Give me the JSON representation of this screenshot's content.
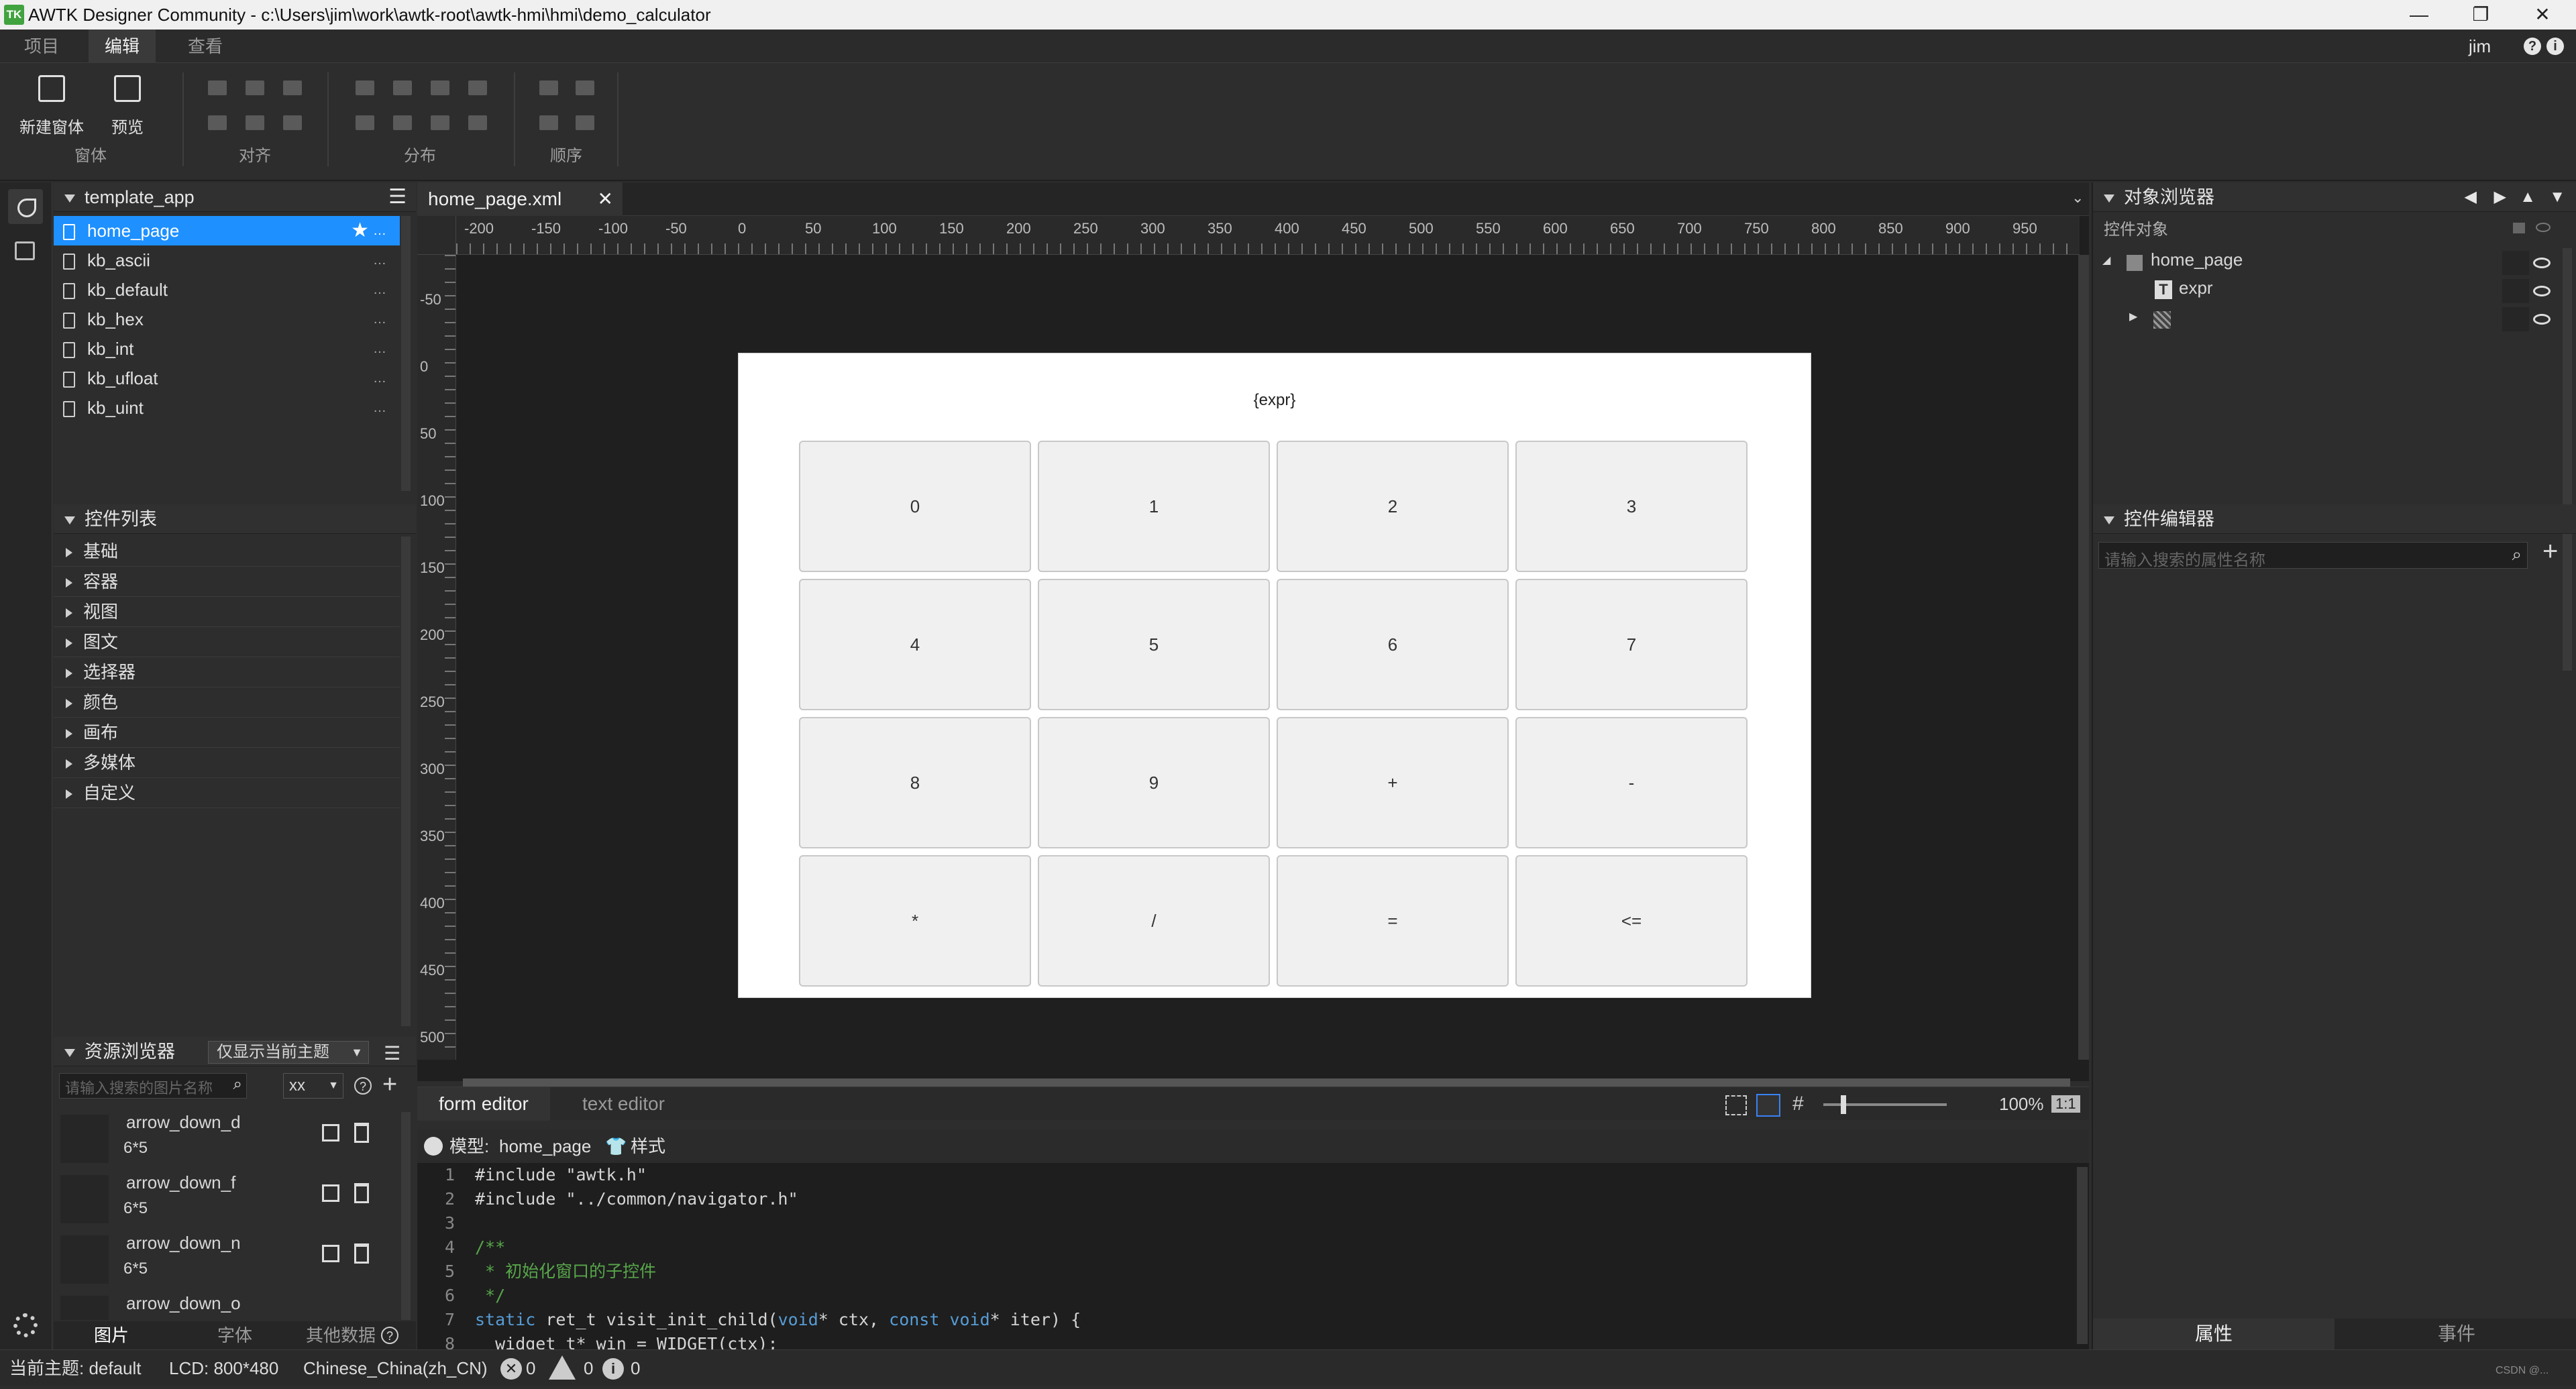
{
  "window": {
    "title": "AWTK Designer Community - c:\\Users\\jim\\work\\awtk-root\\awtk-hmi\\hmi\\demo_calculator",
    "logo": "TK",
    "controls": {
      "minimize": "—",
      "maximize": "❐",
      "close": "✕"
    }
  },
  "menubar": {
    "tabs": [
      "项目",
      "编辑",
      "查看"
    ],
    "user": "jim"
  },
  "ribbon": {
    "new_window": "新建窗体",
    "preview": "预览",
    "groups": {
      "window": "窗体",
      "align": "对齐",
      "distribute": "分布",
      "order": "顺序"
    }
  },
  "project_panel": {
    "title": "template_app",
    "files": [
      "home_page",
      "kb_ascii",
      "kb_default",
      "kb_hex",
      "kb_int",
      "kb_ufloat",
      "kb_uint"
    ],
    "selected": "home_page"
  },
  "widget_list": {
    "title": "控件列表",
    "categories": [
      "基础",
      "容器",
      "视图",
      "图文",
      "选择器",
      "颜色",
      "画布",
      "多媒体",
      "自定义"
    ]
  },
  "resource_browser": {
    "title": "资源浏览器",
    "filter": "仅显示当前主题",
    "search_placeholder": "请输入搜索的图片名称",
    "scale": "xx",
    "items": [
      {
        "name": "arrow_down_d",
        "size": "6*5"
      },
      {
        "name": "arrow_down_f",
        "size": "6*5"
      },
      {
        "name": "arrow_down_n",
        "size": "6*5"
      },
      {
        "name": "arrow_down_o",
        "size": ""
      }
    ],
    "tabs": [
      "图片",
      "字体",
      "其他数据"
    ]
  },
  "editor": {
    "file_tab": "home_page.xml",
    "ruler_h": [
      "-200",
      "-150",
      "-100",
      "-50",
      "0",
      "50",
      "100",
      "150",
      "200",
      "250",
      "300",
      "350",
      "400",
      "450",
      "500",
      "550",
      "600",
      "650",
      "700",
      "750",
      "800",
      "850",
      "900",
      "950"
    ],
    "ruler_v": [
      "-50",
      "0",
      "50",
      "100",
      "150",
      "200",
      "250",
      "300",
      "350",
      "400",
      "450",
      "500"
    ],
    "form": {
      "label": "{expr}",
      "keys": [
        "0",
        "1",
        "2",
        "3",
        "4",
        "5",
        "6",
        "7",
        "8",
        "9",
        "+",
        "-",
        "*",
        "/",
        "=",
        "<="
      ]
    },
    "bottom_tabs": [
      "form editor",
      "text editor"
    ],
    "zoom": "100%",
    "zoom_reset": "1:1"
  },
  "code_panel": {
    "model_label": "模型:",
    "model_name": "home_page",
    "style_label": "样式",
    "lines": [
      {
        "n": "1",
        "text": "#include \"awtk.h\""
      },
      {
        "n": "2",
        "text": "#include \"../common/navigator.h\""
      },
      {
        "n": "3",
        "text": ""
      },
      {
        "n": "4",
        "text": "/**"
      },
      {
        "n": "5",
        "text": " * 初始化窗口的子控件"
      },
      {
        "n": "6",
        "text": " */"
      },
      {
        "n": "7",
        "pre": "static ",
        "type": "ret_t",
        "mid": " visit_init_child(",
        "k1": "void",
        "m2": "* ctx, ",
        "k2": "const void",
        "end": "* iter) {"
      },
      {
        "n": "8",
        "text": "  widget_t* win = WIDGET(ctx);"
      }
    ]
  },
  "object_browser": {
    "title": "对象浏览器",
    "subtitle": "控件对象",
    "tree": [
      {
        "label": "home_page"
      },
      {
        "label": "expr"
      },
      {
        "label": ""
      }
    ]
  },
  "property_editor": {
    "title": "控件编辑器",
    "search_placeholder": "请输入搜索的属性名称",
    "tabs": [
      "属性",
      "事件"
    ]
  },
  "statusbar": {
    "theme": "当前主题: default",
    "lcd": "LCD: 800*480",
    "locale": "Chinese_China(zh_CN)",
    "errors": "0",
    "warnings": "0",
    "infos": "0",
    "watermark": "CSDN @..."
  }
}
